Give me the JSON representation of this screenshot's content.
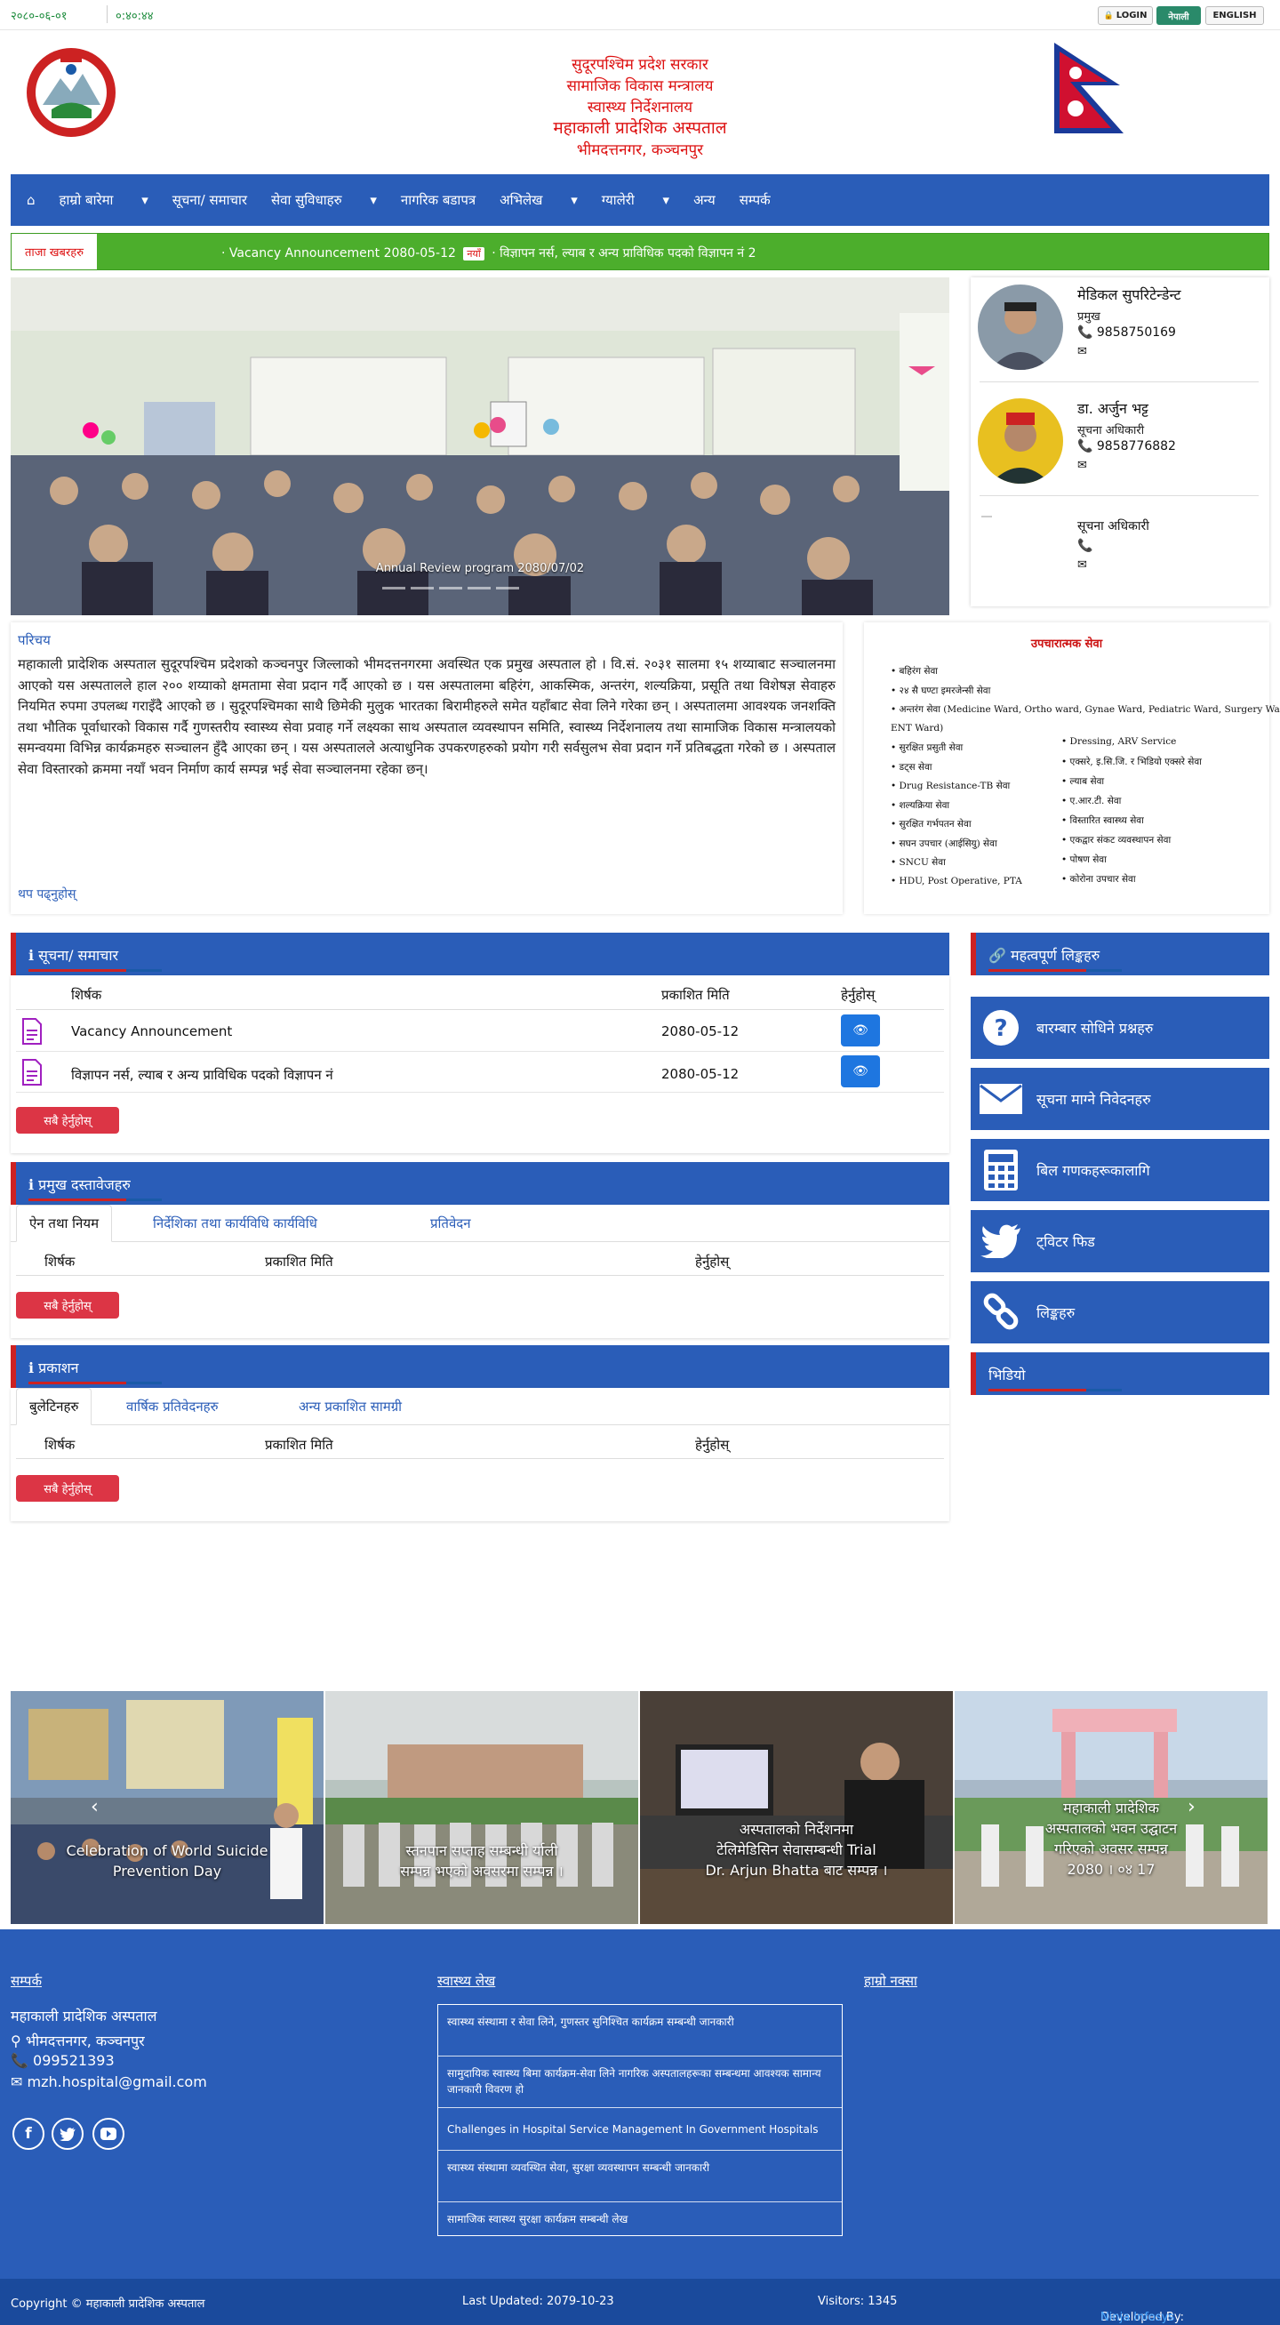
{
  "topbar": {
    "date": "२०८०-०६-०१",
    "time": "०:४०:४४",
    "login": "LOGIN",
    "nepali": "नेपाली",
    "english": "ENGLISH"
  },
  "header": {
    "line1": "सुदूरपश्चिम प्रदेश सरकार",
    "line2": "सामाजिक विकास मन्त्रालय",
    "line3": "स्वास्थ्य निर्देशनालय",
    "line4": "महाकाली प्रादेशिक अस्पताल",
    "line5": "भीमदत्तनगर, कञ्चनपुर"
  },
  "nav": {
    "items": [
      "हाम्रो बारेमा",
      "सूचना/ समाचार",
      "सेवा सुविधाहरु",
      "नागरिक बडापत्र",
      "अभिलेख",
      "ग्यालेरी",
      "अन्य",
      "सम्पर्क"
    ]
  },
  "ticker": {
    "label": "ताजा खबरहरु",
    "item1": "Vacancy Announcement 2080-05-12",
    "new_badge": "नयाँ",
    "item2": "विज्ञापन नर्स, ल्याब र अन्य प्राविधिक पदको विज्ञापन नं 2"
  },
  "slider": {
    "caption": "Annual Review program 2080/07/02"
  },
  "staff": [
    {
      "name": "मेडिकल सुपरिटेन्डेन्ट",
      "role": "प्रमुख",
      "phone": "9858750169"
    },
    {
      "name": "डा. अर्जुन भट्ट",
      "role": "सूचना अधिकारी",
      "phone": "9858776882"
    },
    {
      "name": "सूचना अधिकारी",
      "role": "",
      "phone": ""
    }
  ],
  "intro": {
    "heading": "परिचय",
    "body": "महाकाली प्रादेशिक अस्पताल सुदूरपश्चिम प्रदेशको कञ्चनपुर जिल्लाको भीमदत्तनगरमा अवस्थित एक प्रमुख अस्पताल हो । वि.सं. २०३१ सालमा १५ शय्याबाट सञ्चालनमा आएको यस अस्पतालले हाल २०० शय्याको क्षमतामा सेवा प्रदान गर्दै आएको छ । यस अस्पतालमा बहिरंग, आकस्मिक, अन्तरंग, शल्यक्रिया, प्रसूति तथा विशेषज्ञ सेवाहरु नियमित रुपमा उपलब्ध गराइँदै आएको छ । सुदूरपश्चिमका साथै छिमेकी मुलुक भारतका बिरामीहरुले समेत यहाँबाट सेवा लिने गरेका छन् । अस्पतालमा आवश्यक जनशक्ति तथा भौतिक पूर्वाधारको विकास गर्दै गुणस्तरीय स्वास्थ्य सेवा प्रवाह गर्ने लक्ष्यका साथ अस्पताल व्यवस्थापन समिति, स्वास्थ्य निर्देशनालय तथा सामाजिक विकास मन्त्रालयको समन्वयमा विभिन्न कार्यक्रमहरु सञ्चालन हुँदै आएका छन् । यस अस्पतालले अत्याधुनिक उपकरणहरुको प्रयोग गरी सर्वसुलभ सेवा प्रदान गर्ने प्रतिबद्धता गरेको छ । अस्पताल सेवा विस्तारको क्रममा नयाँ भवन निर्माण कार्य सम्पन्न भई सेवा सञ्चालनमा रहेका छन्।",
    "more": "थप पढ्नुहोस्"
  },
  "services": {
    "title": "उपचारात्मक सेवा",
    "left": [
      "बहिरंग सेवा",
      "२४ सै घण्टा इमरजेन्सी सेवा",
      "अन्तरंग सेवा (Medicine Ward, Ortho ward, Gynae Ward, Pediatric Ward, Surgery Ward,",
      "ENT Ward)",
      "सुरक्षित प्रसुती सेवा",
      "डट्स सेवा",
      "Drug Resistance-TB सेवा",
      "शल्यक्रिया सेवा",
      "सुरक्षित गर्भपतन सेवा",
      "सघन उपचार (आईसियु) सेवा",
      "SNCU सेवा",
      "HDU, Post Operative, PTA"
    ],
    "right": [
      "Dressing, ARV Service",
      "एक्सरे, इ.सि.जि. र भिडियो एक्सरे सेवा",
      "ल्याब सेवा",
      "ए.आर.टी. सेवा",
      "विस्तारित स्वास्थ्य सेवा",
      "एकद्वार संकट व्यवस्थापन सेवा",
      "पोषण सेवा",
      "कोरोना उपचार सेवा"
    ]
  },
  "notices": {
    "title": "सूचना/ समाचार",
    "col_title": "शिर्षक",
    "col_date": "प्रकाशित मिति",
    "col_view": "हेर्नुहोस्",
    "rows": [
      {
        "title": "Vacancy Announcement",
        "date": "2080-05-12"
      },
      {
        "title": "विज्ञापन नर्स, ल्याब र अन्य प्राविधिक पदको विज्ञापन नं",
        "date": "2080-05-12"
      }
    ],
    "all": "सबै हेर्नुहोस्"
  },
  "downloads": {
    "title": "प्रमुख दस्तावेजहरु",
    "tabs": [
      "ऐन तथा नियम",
      "निर्देशिका तथा कार्यविधि कार्यविधि",
      "प्रतिवेदन"
    ],
    "col_title": "शिर्षक",
    "col_date": "प्रकाशित मिति",
    "col_view": "हेर्नुहोस्",
    "all": "सबै हेर्नुहोस्"
  },
  "publications": {
    "title": "प्रकाशन",
    "tabs": [
      "बुलेटिनहरु",
      "वार्षिक प्रतिवेदनहरु",
      "अन्य प्रकाशित सामग्री"
    ],
    "col_title": "शिर्षक",
    "col_date": "प्रकाशित मिति",
    "col_view": "हेर्नुहोस्",
    "all": "सबै हेर्नुहोस्"
  },
  "side": {
    "title": "महत्वपूर्ण लिङ्कहरु",
    "links": [
      "बारम्बार सोधिने प्रश्नहरु",
      "सूचना माग्ने निवेदनहरु",
      "बिल गणकहरूकालागि",
      "ट्विटर फिड",
      "लिङ्कहरु"
    ],
    "section2": "भिडियो"
  },
  "gallery": [
    {
      "caption1": "Celebration of World Suicide",
      "caption2": "Prevention Day"
    },
    {
      "caption1": "स्तनपान सप्ताह सम्बन्धी र्याली",
      "caption2": "सम्पन्न भएको अवसरमा सम्पन्न ।"
    },
    {
      "caption1": "अस्पतालको निर्देशनमा",
      "caption2": "टेलिमेडिसिन सेवासम्बन्धी Trial",
      "caption3": "Dr. Arjun Bhatta बाट सम्पन्न ।"
    },
    {
      "caption1": "महाकाली प्रादेशिक",
      "caption2": "अस्पतालको भवन उद्घाटन",
      "caption3": "गरिएको अवसर सम्पन्न",
      "caption4": "2080 । ०४ 17"
    }
  ],
  "footer": {
    "contact_heading": "सम्पर्क",
    "org": "महाकाली प्रादेशिक अस्पताल",
    "address": "भीमदत्तनगर, कञ्चनपुर",
    "phone": "099521393",
    "email": "mzh.hospital@gmail.com",
    "articles_heading": "स्वास्थ्य लेख",
    "articles": [
      "स्वास्थ्य संस्थामा र सेवा लिने, गुणस्तर सुनिश्चित कार्यक्रम सम्बन्धी जानकारी",
      "सामुदायिक स्वास्थ्य बिमा कार्यक्रम-सेवा लिने नागरिक अस्पतालहरूका सम्बन्धमा आवश्यक सामान्य जानकारी विवरण हो",
      "Challenges in Hospital Service Management In Government Hospitals",
      "स्वास्थ्य संस्थामा व्यवस्थित सेवा, सुरक्षा व्यवस्थापन सम्बन्धी जानकारी",
      "सामाजिक स्वास्थ्य सुरक्षा कार्यक्रम सम्बन्धी लेख"
    ],
    "map_heading": "हाम्रो नक्सा"
  },
  "bottom": {
    "copyright": "Copyright © महाकाली प्रादेशिक अस्पताल",
    "updated": "Last Updated: 2079-10-23",
    "visitors": "Visitors: 1345",
    "dev_prefix": "Developed By:",
    "dev": "Ninja Infosys"
  }
}
